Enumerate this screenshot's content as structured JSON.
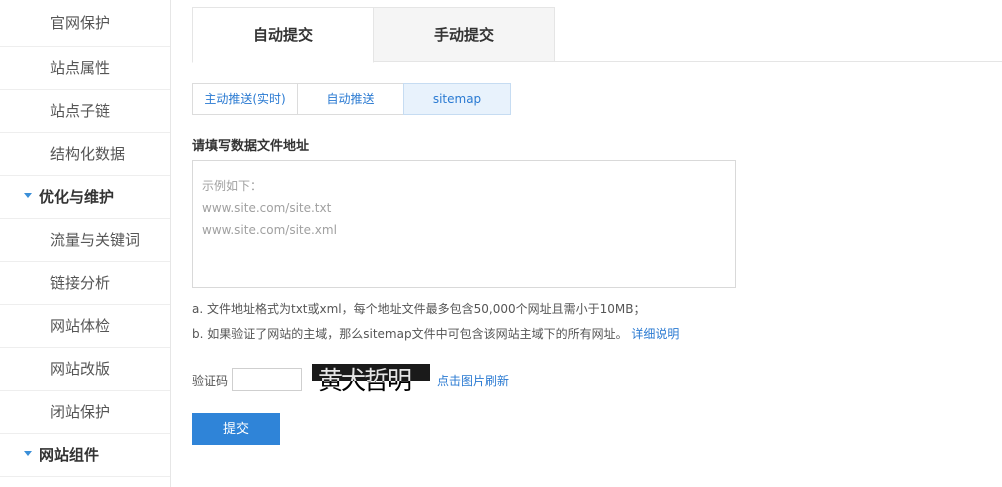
{
  "sidebar": {
    "items_top": [
      {
        "label": "官网保护"
      },
      {
        "label": "站点属性"
      },
      {
        "label": "站点子链"
      },
      {
        "label": "结构化数据"
      }
    ],
    "group1": {
      "label": "优化与维护"
    },
    "items_mid": [
      {
        "label": "流量与关键词"
      },
      {
        "label": "链接分析"
      },
      {
        "label": "网站体检"
      },
      {
        "label": "网站改版"
      },
      {
        "label": "闭站保护"
      }
    ],
    "group2": {
      "label": "网站组件"
    }
  },
  "top_tabs": [
    {
      "label": "自动提交",
      "active": true
    },
    {
      "label": "手动提交",
      "active": false
    }
  ],
  "sub_tabs": [
    {
      "label": "主动推送(实时)"
    },
    {
      "label": "自动推送"
    },
    {
      "label": "sitemap",
      "active": true
    }
  ],
  "form": {
    "field_title": "请填写数据文件地址",
    "placeholder_lines": [
      "示例如下：",
      "www.site.com/site.txt",
      "www.site.com/site.xml"
    ],
    "note_a": "a. 文件地址格式为txt或xml，每个地址文件最多包含50,000个网址且需小于10MB；",
    "note_b": "b. 如果验证了网站的主域，那么sitemap文件中可包含该网站主域下的所有网址。",
    "note_b_link": "详细说明",
    "captcha_label": "验证码",
    "captcha_value": "",
    "captcha_image_text": "黄犬哲明",
    "captcha_refresh": "点击图片刷新",
    "submit_label": "提交"
  },
  "colors": {
    "accent": "#2f84d8",
    "link": "#2a7ad2",
    "selected_tab_bg": "#e8f2fc",
    "inactive_tab_bg": "#f5f5f5"
  },
  "icons": {
    "group_expand": "triangle-down-icon"
  }
}
